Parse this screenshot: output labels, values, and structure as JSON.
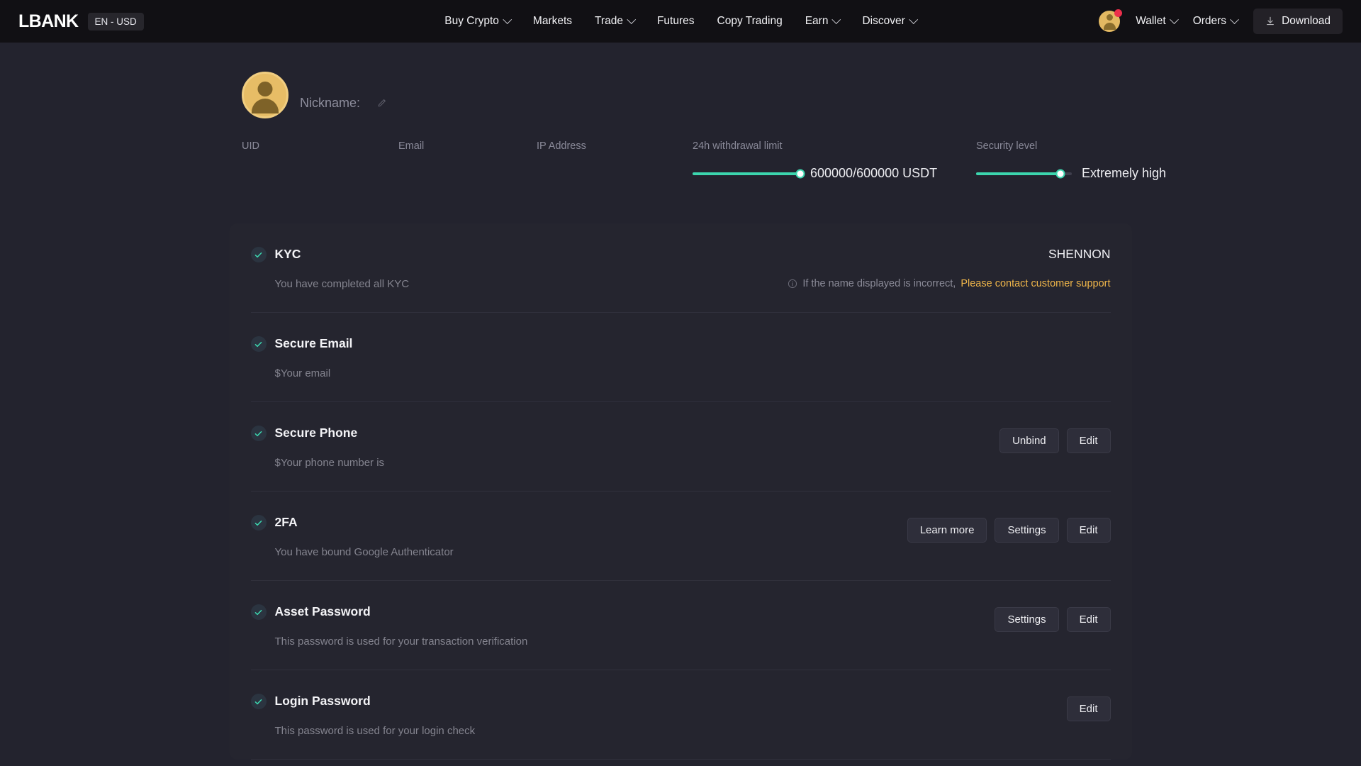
{
  "header": {
    "logo": "LBANK",
    "lang_currency": "EN - USD",
    "nav": [
      {
        "label": "Buy Crypto",
        "has_dropdown": true
      },
      {
        "label": "Markets",
        "has_dropdown": false
      },
      {
        "label": "Trade",
        "has_dropdown": true
      },
      {
        "label": "Futures",
        "has_dropdown": false
      },
      {
        "label": "Copy Trading",
        "has_dropdown": false
      },
      {
        "label": "Earn",
        "has_dropdown": true
      },
      {
        "label": "Discover",
        "has_dropdown": true
      }
    ],
    "wallet_label": "Wallet",
    "orders_label": "Orders",
    "download_label": "Download",
    "icons": {
      "avatar": "user-avatar-icon",
      "notification_dot": "notification-badge",
      "download": "download-icon"
    }
  },
  "profile": {
    "nickname_label": "Nickname:",
    "nickname_value": "",
    "edit_icon": "pencil-edit-icon",
    "uid_label": "UID",
    "uid_value": "",
    "email_label": "Email",
    "email_value": "",
    "ip_label": "IP Address",
    "ip_value": "",
    "withdrawal_label": "24h withdrawal limit",
    "withdrawal_value": "600000/600000 USDT",
    "withdrawal_percent": 100,
    "security_label": "Security level",
    "security_value": "Extremely high",
    "security_percent": 88,
    "accent_color": "#3cd6ae"
  },
  "security_rows": [
    {
      "title": "KYC",
      "desc": "You have completed all KYC",
      "status_icon": "check-circle-icon",
      "kyc_name": "SHENNON",
      "note_prefix": "If the name displayed is incorrect,",
      "note_link": "Please contact customer support",
      "note_link_color": "#f0b64a",
      "buttons": []
    },
    {
      "title": "Secure Email",
      "desc": "$Your email",
      "status_icon": "check-circle-icon",
      "buttons": []
    },
    {
      "title": "Secure Phone",
      "desc": "$Your phone number is",
      "status_icon": "check-circle-icon",
      "buttons": [
        "Unbind",
        "Edit"
      ]
    },
    {
      "title": "2FA",
      "desc": "You have bound Google Authenticator",
      "status_icon": "check-circle-icon",
      "buttons": [
        "Learn more",
        "Settings",
        "Edit"
      ]
    },
    {
      "title": "Asset Password",
      "desc": "This password is used for your transaction verification",
      "status_icon": "check-circle-icon",
      "buttons": [
        "Settings",
        "Edit"
      ]
    },
    {
      "title": "Login Password",
      "desc": "This password is used for your login check",
      "status_icon": "check-circle-icon",
      "buttons": [
        "Edit"
      ]
    }
  ]
}
